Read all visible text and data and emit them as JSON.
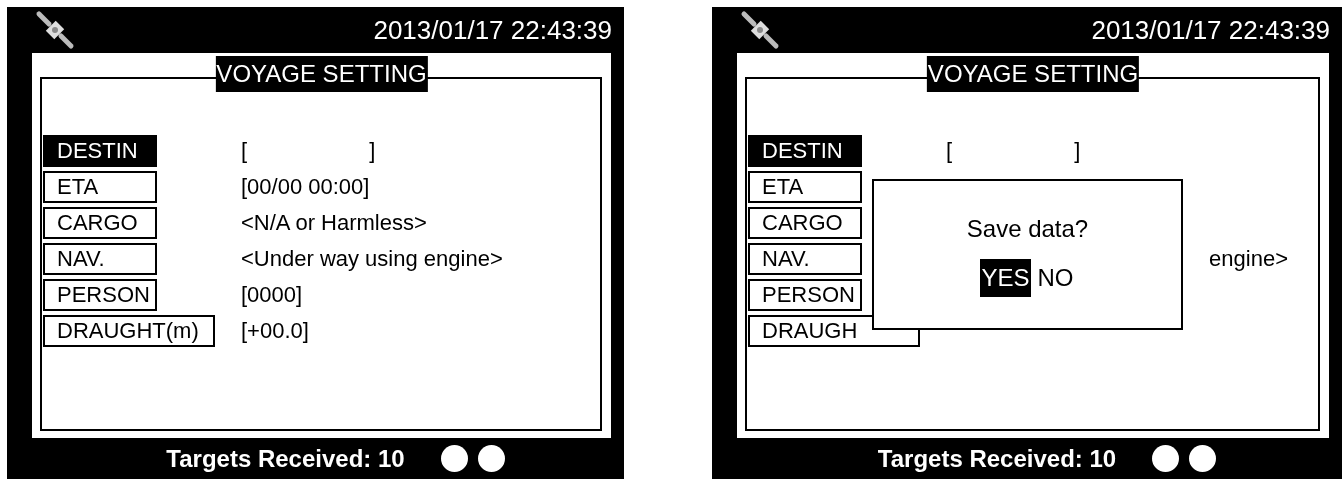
{
  "screens": [
    {
      "datetime": "2013/01/17 22:43:39",
      "title": "VOYAGE SETTING",
      "rows": [
        {
          "label": "DESTIN",
          "selected": true,
          "value": "[                    ]"
        },
        {
          "label": "ETA",
          "selected": false,
          "value": "[00/00 00:00]"
        },
        {
          "label": "CARGO",
          "selected": false,
          "value": "<N/A or Harmless>"
        },
        {
          "label": "NAV.",
          "selected": false,
          "value": "<Under way using engine>"
        },
        {
          "label": "PERSON",
          "selected": false,
          "value": "[0000]"
        },
        {
          "label": "DRAUGHT(m)",
          "selected": false,
          "value": "[+00.0]",
          "kind": "wide"
        }
      ],
      "footer": "Targets Received: 10"
    },
    {
      "datetime": "2013/01/17 22:43:39",
      "title": "VOYAGE SETTING",
      "rows": [
        {
          "label": "DESTIN",
          "selected": true,
          "value": "[                    ]"
        },
        {
          "label": "ETA",
          "selected": false
        },
        {
          "label": "CARGO",
          "selected": false
        },
        {
          "label": "NAV.",
          "selected": false,
          "value": "engine>",
          "kind": "clipped"
        },
        {
          "label": "PERSON",
          "selected": false
        },
        {
          "label": "DRAUGH",
          "selected": false,
          "kind": "wide"
        }
      ],
      "footer": "Targets Received: 10",
      "dialog": {
        "message": "Save data?",
        "options": [
          {
            "label": "YES",
            "selected": true
          },
          {
            "label": "NO",
            "selected": false
          }
        ]
      }
    }
  ]
}
